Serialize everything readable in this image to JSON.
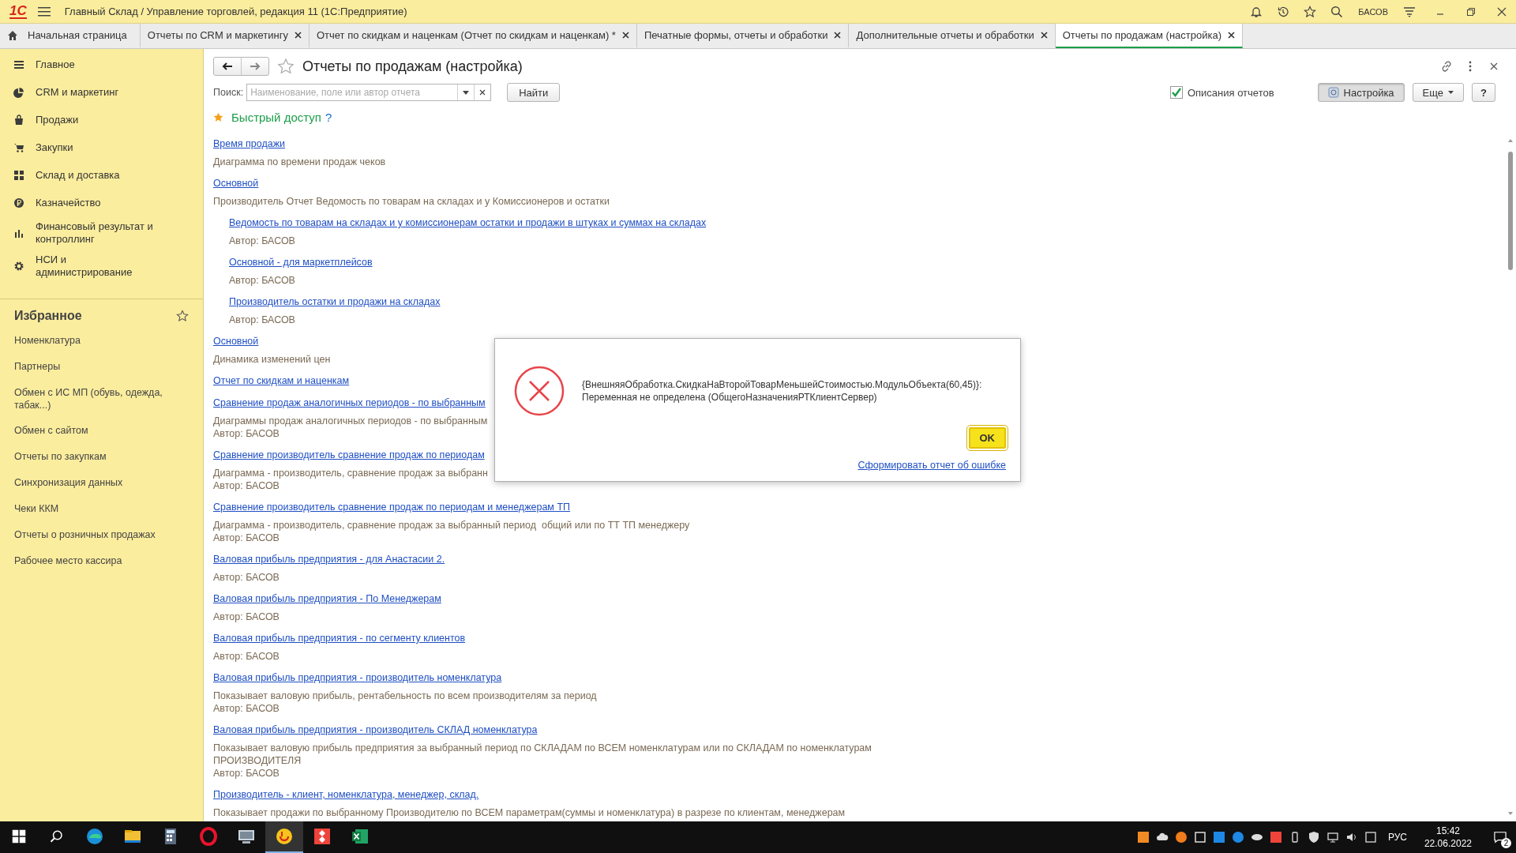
{
  "window": {
    "logo": "1С",
    "title": "Главный Склад / Управление торговлей, редакция 11  (1С:Предприятие)",
    "user": "БАСОВ"
  },
  "tabs": [
    {
      "kind": "home",
      "label": "Начальная страница",
      "selected": false
    },
    {
      "kind": "document",
      "label": "Отчеты по CRM и маркетингу",
      "selected": false
    },
    {
      "kind": "document",
      "label": "Отчет по скидкам и наценкам (Отчет по скидкам и наценкам) *",
      "selected": false
    },
    {
      "kind": "document",
      "label": "Печатные формы, отчеты и обработки",
      "selected": false
    },
    {
      "kind": "document",
      "label": "Дополнительные отчеты и обработки",
      "selected": false
    },
    {
      "kind": "document",
      "label": "Отчеты по продажам (настройка)",
      "selected": true
    }
  ],
  "sidebar": {
    "sections": [
      {
        "kind": "menu",
        "label": "Главное"
      },
      {
        "kind": "pie",
        "label": "CRM и маркетинг"
      },
      {
        "kind": "bag",
        "label": "Продажи"
      },
      {
        "kind": "cart",
        "label": "Закупки"
      },
      {
        "kind": "grid",
        "label": "Склад и доставка"
      },
      {
        "kind": "ruble",
        "label": "Казначейство"
      },
      {
        "kind": "bars",
        "label": "Финансовый результат и контроллинг"
      },
      {
        "kind": "gear",
        "label": "НСИ и администрирование"
      }
    ],
    "favorites": {
      "title": "Избранное",
      "items": [
        "Номенклатура",
        "Партнеры",
        "Обмен с ИС МП (обувь, одежда, табак...)",
        "Обмен с сайтом",
        "Отчеты по закупкам",
        "Синхронизация данных",
        "Чеки ККМ",
        "Отчеты о розничных продажах",
        "Рабочее место кассира"
      ]
    }
  },
  "form": {
    "title": "Отчеты по продажам (настройка)",
    "search": {
      "label": "Поиск:",
      "placeholder": "Наименование, поле или автор отчета"
    },
    "find_button": "Найти",
    "descriptions_checkbox": {
      "label": "Описания отчетов",
      "checked": true
    },
    "settings_button": {
      "label": "Настройка",
      "selected": true
    },
    "more_button": "Еще",
    "help_button": "?"
  },
  "quick_access": {
    "title": "Быстрый доступ",
    "help": "?"
  },
  "reports": [
    {
      "link": "Время продажи",
      "lines": [
        "Диаграмма по времени продаж чеков"
      ]
    },
    {
      "link": "Основной",
      "lines": [
        "Производитель Отчет Ведомость по товарам на складах и у Комиссионеров и остатки"
      ],
      "children": [
        {
          "link": "Ведомость по товарам на складах и у комиссионерам остатки и продажи в штуках и суммах на складах",
          "lines": [
            "Автор: БАСОВ"
          ]
        },
        {
          "link": "Основной - для маркетплейсов",
          "lines": [
            "Автор: БАСОВ"
          ]
        },
        {
          "link": "Производитель остатки и продажи на складах",
          "lines": [
            "Автор: БАСОВ"
          ]
        }
      ]
    },
    {
      "link": "Основной",
      "lines": [
        "Динамика изменений цен"
      ]
    },
    {
      "link": "Отчет по скидкам и наценкам"
    },
    {
      "link": "Сравнение продаж аналогичных периодов - по выбранным",
      "lines": [
        "Диаграммы продаж аналогичных периодов - по выбранным",
        "Автор: БАСОВ"
      ]
    },
    {
      "link": "Сравнение производитель сравнение продаж по периодам",
      "lines": [
        "Диаграмма - производитель, сравнение продаж за выбранн",
        "Автор: БАСОВ"
      ]
    },
    {
      "link": "Сравнение производитель сравнение продаж по периодам и менеджерам ТП",
      "lines": [
        "Диаграмма - производитель, сравнение продаж за выбранный период  общий или по ТТ ТП менеджеру",
        "Автор: БАСОВ"
      ]
    },
    {
      "link": "Валовая прибыль предприятия - для Анастасии 2.",
      "lines": [
        "Автор: БАСОВ"
      ]
    },
    {
      "link": "Валовая прибыль предприятия - По Менеджерам",
      "lines": [
        "Автор: БАСОВ"
      ]
    },
    {
      "link": "Валовая прибыль предприятия - по сегменту клиентов",
      "lines": [
        "Автор: БАСОВ"
      ]
    },
    {
      "link": "Валовая прибыль предприятия - производитель номенклатура",
      "lines": [
        "Показывает валовую прибыль, рентабельность по всем производителям за период",
        "Автор: БАСОВ"
      ]
    },
    {
      "link": "Валовая прибыль предприятия - производитель СКЛАД номенклатура",
      "lines": [
        "Показывает валовую прибыль предприятия за выбранный период по СКЛАДАМ по ВСЕМ номенклатурам или по СКЛАДАМ по номенклатурам\nПРОИЗВОДИТЕЛЯ",
        "Автор: БАСОВ"
      ]
    },
    {
      "link": "Производитель - клиент, номенклатура, менеджер, склад.",
      "lines": [
        "Показывает продажи по выбранному Производителю по ВСЕМ параметрам(суммы и номенклатура) в разрезе по клиентам, менеджерам"
      ]
    }
  ],
  "dialog": {
    "message": "{ВнешняяОбработка.СкидкаНаВторойТоварМеньшейСтоимостью.МодульОбъекта(60,45)}:\nПеременная не определена (ОбщегоНазначенияРТКлиентСервер)",
    "ok_button": "OK",
    "report_link": "Сформировать отчет об ошибке"
  },
  "taskbar": {
    "apps": [
      {
        "kind": "edge",
        "selected": false
      },
      {
        "kind": "explorer",
        "selected": false
      },
      {
        "kind": "calculator",
        "selected": false
      },
      {
        "kind": "opera",
        "selected": false
      },
      {
        "kind": "monitor",
        "selected": false
      },
      {
        "kind": "onec",
        "selected": true
      },
      {
        "kind": "anydesk",
        "selected": false
      },
      {
        "kind": "excel",
        "selected": false
      }
    ],
    "language": "РУС",
    "time": "15:42",
    "date": "22.06.2022",
    "notifications": "2"
  }
}
